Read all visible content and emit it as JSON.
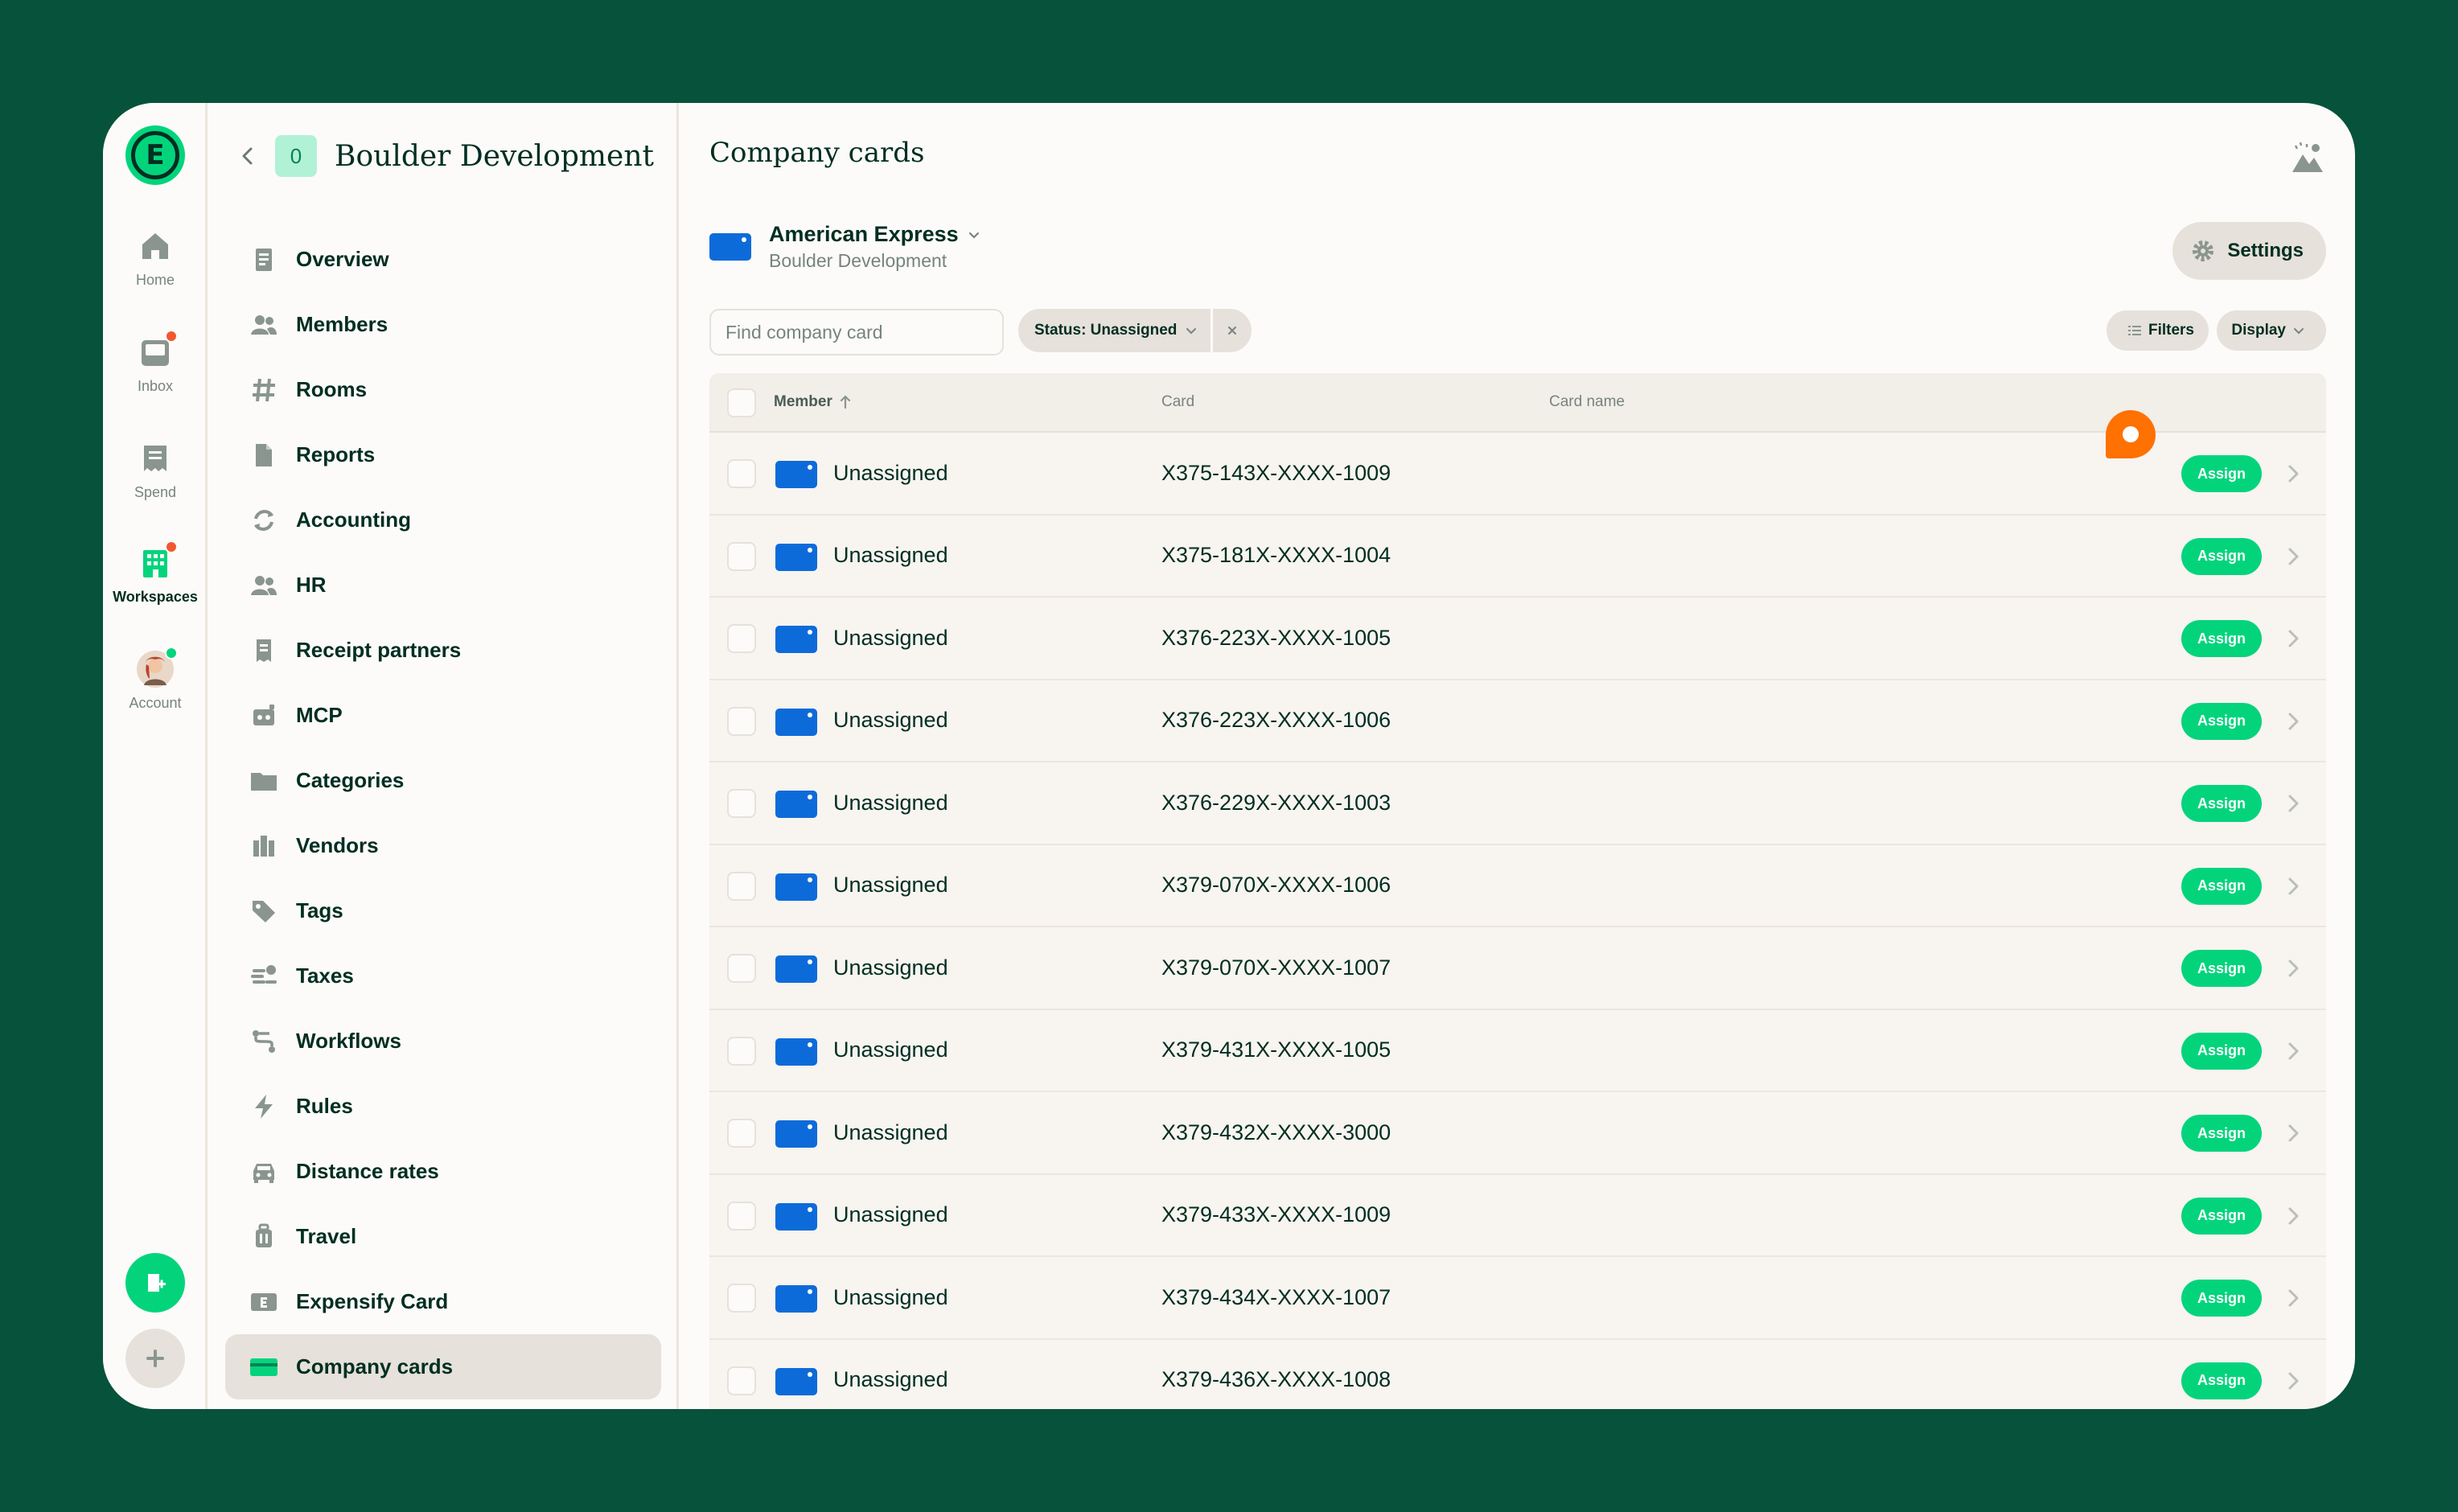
{
  "colors": {
    "brand_green": "#03d47c",
    "background_dark": "#07523a",
    "card_blue": "#0d6bd9",
    "alert_red": "#f25730",
    "orange": "#ff7101"
  },
  "rail": {
    "items": [
      {
        "label": "Home",
        "icon": "home-icon"
      },
      {
        "label": "Inbox",
        "icon": "inbox-icon"
      },
      {
        "label": "Spend",
        "icon": "receipt-icon"
      },
      {
        "label": "Workspaces",
        "icon": "building-icon"
      },
      {
        "label": "Account",
        "icon": "avatar"
      }
    ]
  },
  "workspace": {
    "avatar_letter": "0",
    "name": "Boulder Development"
  },
  "nav": {
    "items": [
      {
        "label": "Overview",
        "icon": "document-icon"
      },
      {
        "label": "Members",
        "icon": "users-icon"
      },
      {
        "label": "Rooms",
        "icon": "hashtag-icon"
      },
      {
        "label": "Reports",
        "icon": "page-icon"
      },
      {
        "label": "Accounting",
        "icon": "sync-icon"
      },
      {
        "label": "HR",
        "icon": "users-icon"
      },
      {
        "label": "Receipt partners",
        "icon": "receipt-icon"
      },
      {
        "label": "MCP",
        "icon": "robot-icon"
      },
      {
        "label": "Categories",
        "icon": "folder-icon"
      },
      {
        "label": "Vendors",
        "icon": "building-icon"
      },
      {
        "label": "Tags",
        "icon": "tag-icon"
      },
      {
        "label": "Taxes",
        "icon": "coins-icon"
      },
      {
        "label": "Workflows",
        "icon": "workflow-icon"
      },
      {
        "label": "Rules",
        "icon": "lightning-icon"
      },
      {
        "label": "Distance rates",
        "icon": "car-icon"
      },
      {
        "label": "Travel",
        "icon": "luggage-icon"
      },
      {
        "label": "Expensify Card",
        "icon": "expensify-card-icon"
      },
      {
        "label": "Company cards",
        "icon": "credit-card-icon"
      }
    ]
  },
  "main": {
    "title": "Company cards",
    "feed": {
      "name": "American Express",
      "workspace": "Boulder Development"
    },
    "settings_label": "Settings",
    "search_placeholder": "Find company card",
    "status_chip": "Status: Unassigned",
    "filters_label": "Filters",
    "display_label": "Display",
    "columns": {
      "member": "Member",
      "card": "Card",
      "card_name": "Card name"
    },
    "assign_label": "Assign",
    "rows": [
      {
        "member": "Unassigned",
        "card": "X375-143X-XXXX-1009"
      },
      {
        "member": "Unassigned",
        "card": "X375-181X-XXXX-1004"
      },
      {
        "member": "Unassigned",
        "card": "X376-223X-XXXX-1005"
      },
      {
        "member": "Unassigned",
        "card": "X376-223X-XXXX-1006"
      },
      {
        "member": "Unassigned",
        "card": "X376-229X-XXXX-1003"
      },
      {
        "member": "Unassigned",
        "card": "X379-070X-XXXX-1006"
      },
      {
        "member": "Unassigned",
        "card": "X379-070X-XXXX-1007"
      },
      {
        "member": "Unassigned",
        "card": "X379-431X-XXXX-1005"
      },
      {
        "member": "Unassigned",
        "card": "X379-432X-XXXX-3000"
      },
      {
        "member": "Unassigned",
        "card": "X379-433X-XXXX-1009"
      },
      {
        "member": "Unassigned",
        "card": "X379-434X-XXXX-1007"
      },
      {
        "member": "Unassigned",
        "card": "X379-436X-XXXX-1008"
      }
    ]
  }
}
